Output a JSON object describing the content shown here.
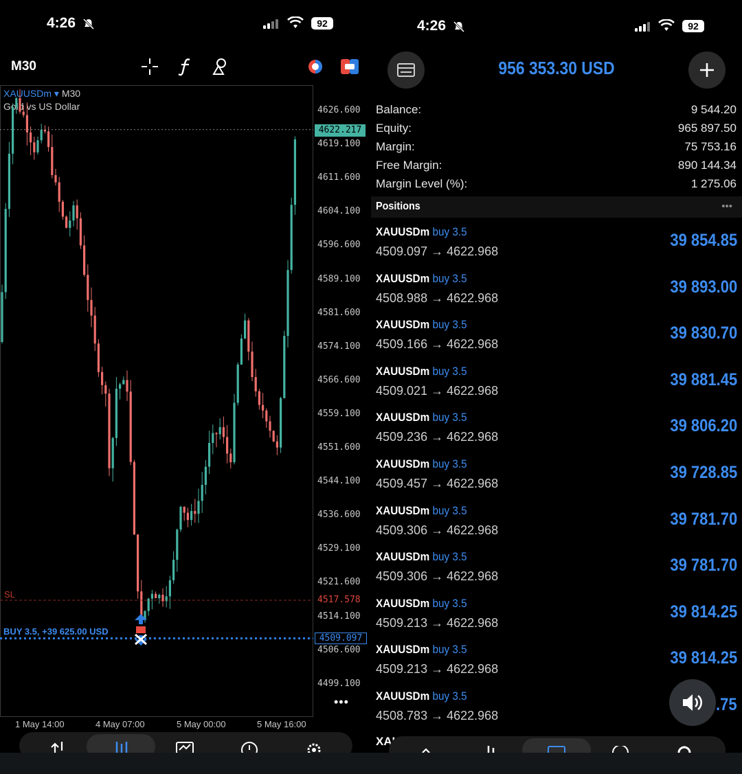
{
  "left_status": {
    "time": "4:26",
    "battery": "92"
  },
  "right_status": {
    "time": "4:26",
    "battery": "92"
  },
  "chart_header": {
    "timeframe": "M30",
    "symbol": "XAUUSDm",
    "symbol_timeframe": "M30",
    "description": "Gold vs US Dollar",
    "menu_icon": "more-icon"
  },
  "chart_data": {
    "type": "candlestick",
    "price_ticks": [
      "4626.600",
      "4619.100",
      "4611.600",
      "4604.100",
      "4596.600",
      "4589.100",
      "4581.600",
      "4574.100",
      "4566.600",
      "4559.100",
      "4551.600",
      "4544.100",
      "4536.600",
      "4529.100",
      "4521.600",
      "4514.100",
      "4506.600",
      "4499.100"
    ],
    "time_ticks": [
      "1 May 14:00",
      "4 May 07:00",
      "5 May 00:00",
      "5 May 16:00"
    ],
    "current_price": "4622.217",
    "sl_label": "SL",
    "sl_price": "4517.578",
    "trade_label": "BUY 3.5, +39 625.00 USD",
    "trade_price": "4509.097",
    "colors": {
      "bull": "#45b3a2",
      "bear": "#ef6f6c"
    }
  },
  "account": {
    "total": "956 353.30 USD",
    "rows": [
      {
        "label": "Balance:",
        "value": "9 544.20"
      },
      {
        "label": "Equity:",
        "value": "965 897.50"
      },
      {
        "label": "Margin:",
        "value": "75 753.16"
      },
      {
        "label": "Free Margin:",
        "value": "890 144.34"
      },
      {
        "label": "Margin Level (%):",
        "value": "1 275.06"
      }
    ],
    "positions_title": "Positions",
    "positions_menu": "•••"
  },
  "positions": [
    {
      "symbol": "XAUUSDm",
      "side": "buy 3.5",
      "prices": "4509.097 → 4622.968",
      "profit": "39 854.85"
    },
    {
      "symbol": "XAUUSDm",
      "side": "buy 3.5",
      "prices": "4508.988 → 4622.968",
      "profit": "39 893.00"
    },
    {
      "symbol": "XAUUSDm",
      "side": "buy 3.5",
      "prices": "4509.166 → 4622.968",
      "profit": "39 830.70"
    },
    {
      "symbol": "XAUUSDm",
      "side": "buy 3.5",
      "prices": "4509.021 → 4622.968",
      "profit": "39 881.45"
    },
    {
      "symbol": "XAUUSDm",
      "side": "buy 3.5",
      "prices": "4509.236 → 4622.968",
      "profit": "39 806.20"
    },
    {
      "symbol": "XAUUSDm",
      "side": "buy 3.5",
      "prices": "4509.457 → 4622.968",
      "profit": "39 728.85"
    },
    {
      "symbol": "XAUUSDm",
      "side": "buy 3.5",
      "prices": "4509.306 → 4622.968",
      "profit": "39 781.70"
    },
    {
      "symbol": "XAUUSDm",
      "side": "buy 3.5",
      "prices": "4509.306 → 4622.968",
      "profit": "39 781.70"
    },
    {
      "symbol": "XAUUSDm",
      "side": "buy 3.5",
      "prices": "4509.213 → 4622.968",
      "profit": "39 814.25"
    },
    {
      "symbol": "XAUUSDm",
      "side": "buy 3.5",
      "prices": "4509.213 → 4622.968",
      "profit": "39 814.25"
    },
    {
      "symbol": "XAUUSDm",
      "side": "buy 3.5",
      "prices": "4508.783 → 4622.968",
      "profit": "3   .75"
    }
  ],
  "partial_row": {
    "symbol": "XAU"
  }
}
